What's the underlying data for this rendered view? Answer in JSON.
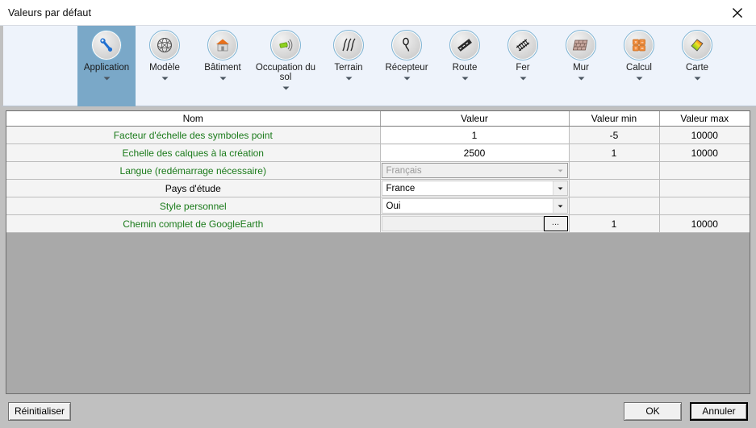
{
  "window": {
    "title": "Valeurs par défaut",
    "close_icon": "close-icon"
  },
  "ribbon": {
    "items": [
      {
        "label": "Application",
        "icon": "wrench-icon",
        "selected": true,
        "caret": true,
        "wide": false
      },
      {
        "label": "Modèle",
        "icon": "globe-mesh-icon",
        "selected": false,
        "caret": true,
        "wide": false
      },
      {
        "label": "Bâtiment",
        "icon": "building-icon",
        "selected": false,
        "caret": true,
        "wide": false
      },
      {
        "label": "Occupation du sol",
        "icon": "landuse-icon",
        "selected": false,
        "caret": true,
        "wide": true
      },
      {
        "label": "Terrain",
        "icon": "terrain-icon",
        "selected": false,
        "caret": true,
        "wide": false
      },
      {
        "label": "Récepteur",
        "icon": "receiver-icon",
        "selected": false,
        "caret": true,
        "wide": false
      },
      {
        "label": "Route",
        "icon": "road-icon",
        "selected": false,
        "caret": true,
        "wide": false
      },
      {
        "label": "Fer",
        "icon": "railway-icon",
        "selected": false,
        "caret": true,
        "wide": false
      },
      {
        "label": "Mur",
        "icon": "wall-icon",
        "selected": false,
        "caret": true,
        "wide": false
      },
      {
        "label": "Calcul",
        "icon": "calculator-icon",
        "selected": false,
        "caret": true,
        "wide": false
      },
      {
        "label": "Carte",
        "icon": "colormap-icon",
        "selected": false,
        "caret": true,
        "wide": false
      }
    ]
  },
  "table": {
    "headers": [
      "Nom",
      "Valeur",
      "Valeur min",
      "Valeur max"
    ],
    "rows": [
      {
        "name": "Facteur d'échelle des symboles point",
        "editor": "text",
        "value": "1",
        "min": "-5",
        "max": "10000"
      },
      {
        "name": "Echelle des calques à la création",
        "editor": "text",
        "value": "2500",
        "min": "1",
        "max": "10000"
      },
      {
        "name": "Langue (redémarrage nécessaire)",
        "editor": "combo-disabled",
        "value": "Français",
        "min": "",
        "max": ""
      },
      {
        "name": "Pays d'étude",
        "editor": "combo",
        "value": "France",
        "min": "",
        "max": ""
      },
      {
        "name": "Style personnel",
        "editor": "combo",
        "value": "Oui",
        "min": "",
        "max": ""
      },
      {
        "name": "Chemin complet de GoogleEarth",
        "editor": "browse",
        "value": "",
        "browse_label": "...",
        "min": "1",
        "max": "10000"
      }
    ]
  },
  "footer": {
    "reset_label": "Réinitialiser",
    "ok_label": "OK",
    "cancel_label": "Annuler"
  },
  "colors": {
    "ribbon_bg": "#eef3fb",
    "selected_tab": "#7aa8c8",
    "name_text": "#1a7a1a",
    "grid_filler": "#a9a9a9",
    "dialog_bg": "#c0c0c0"
  }
}
